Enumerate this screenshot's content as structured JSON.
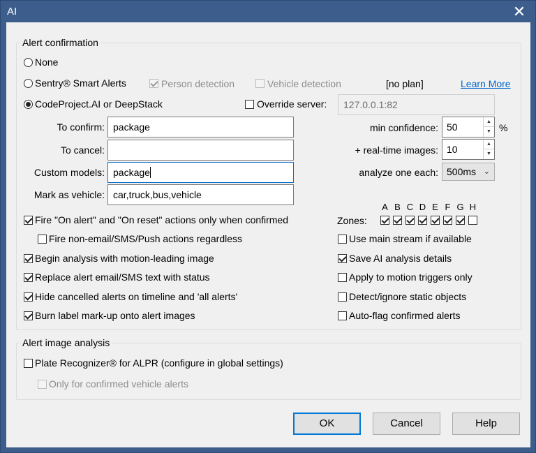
{
  "window": {
    "title": "AI",
    "close_glyph": "✕"
  },
  "alert_confirmation": {
    "title": "Alert confirmation",
    "radio_none": "None",
    "radio_sentry": "Sentry® Smart Alerts",
    "person_detection": "Person detection",
    "vehicle_detection": "Vehicle detection",
    "no_plan": "[no plan]",
    "learn_more": "Learn More",
    "radio_codeproject": "CodeProject.AI or DeepStack",
    "override_server": "Override server:",
    "override_server_value": "127.0.0.1:82",
    "to_confirm_label": "To confirm:",
    "to_confirm_value": "package",
    "to_cancel_label": "To cancel:",
    "to_cancel_value": "",
    "custom_models_label": "Custom models:",
    "custom_models_value": "package",
    "mark_vehicle_label": "Mark as vehicle:",
    "mark_vehicle_value": "car,truck,bus,vehicle",
    "min_confidence_label": "min confidence:",
    "min_confidence_value": "50",
    "percent": "%",
    "realtime_label": "+ real-time images:",
    "realtime_value": "10",
    "analyze_label": "analyze one each:",
    "analyze_value": "500ms",
    "zones_label": "Zones:",
    "zones": [
      {
        "letter": "A",
        "checked": true
      },
      {
        "letter": "B",
        "checked": true
      },
      {
        "letter": "C",
        "checked": true
      },
      {
        "letter": "D",
        "checked": true
      },
      {
        "letter": "E",
        "checked": true
      },
      {
        "letter": "F",
        "checked": true
      },
      {
        "letter": "G",
        "checked": true
      },
      {
        "letter": "H",
        "checked": false
      }
    ],
    "left_options": [
      "Fire \"On alert\" and \"On reset\" actions only when confirmed",
      "Fire non-email/SMS/Push actions regardless",
      "Begin analysis with motion-leading image",
      "Replace alert email/SMS text with status",
      "Hide cancelled alerts on timeline and  'all alerts'",
      "Burn label mark-up onto alert images"
    ],
    "right_options": [
      "Use main stream if available",
      "Save AI analysis details",
      "Apply to motion triggers only",
      "Detect/ignore static objects",
      "Auto-flag confirmed alerts"
    ]
  },
  "alert_image_analysis": {
    "title": "Alert image analysis",
    "plate_recognizer": "Plate Recognizer® for ALPR (configure in global settings)",
    "only_confirmed_vehicle": "Only for confirmed vehicle alerts"
  },
  "buttons": {
    "ok": "OK",
    "cancel": "Cancel",
    "help": "Help"
  }
}
